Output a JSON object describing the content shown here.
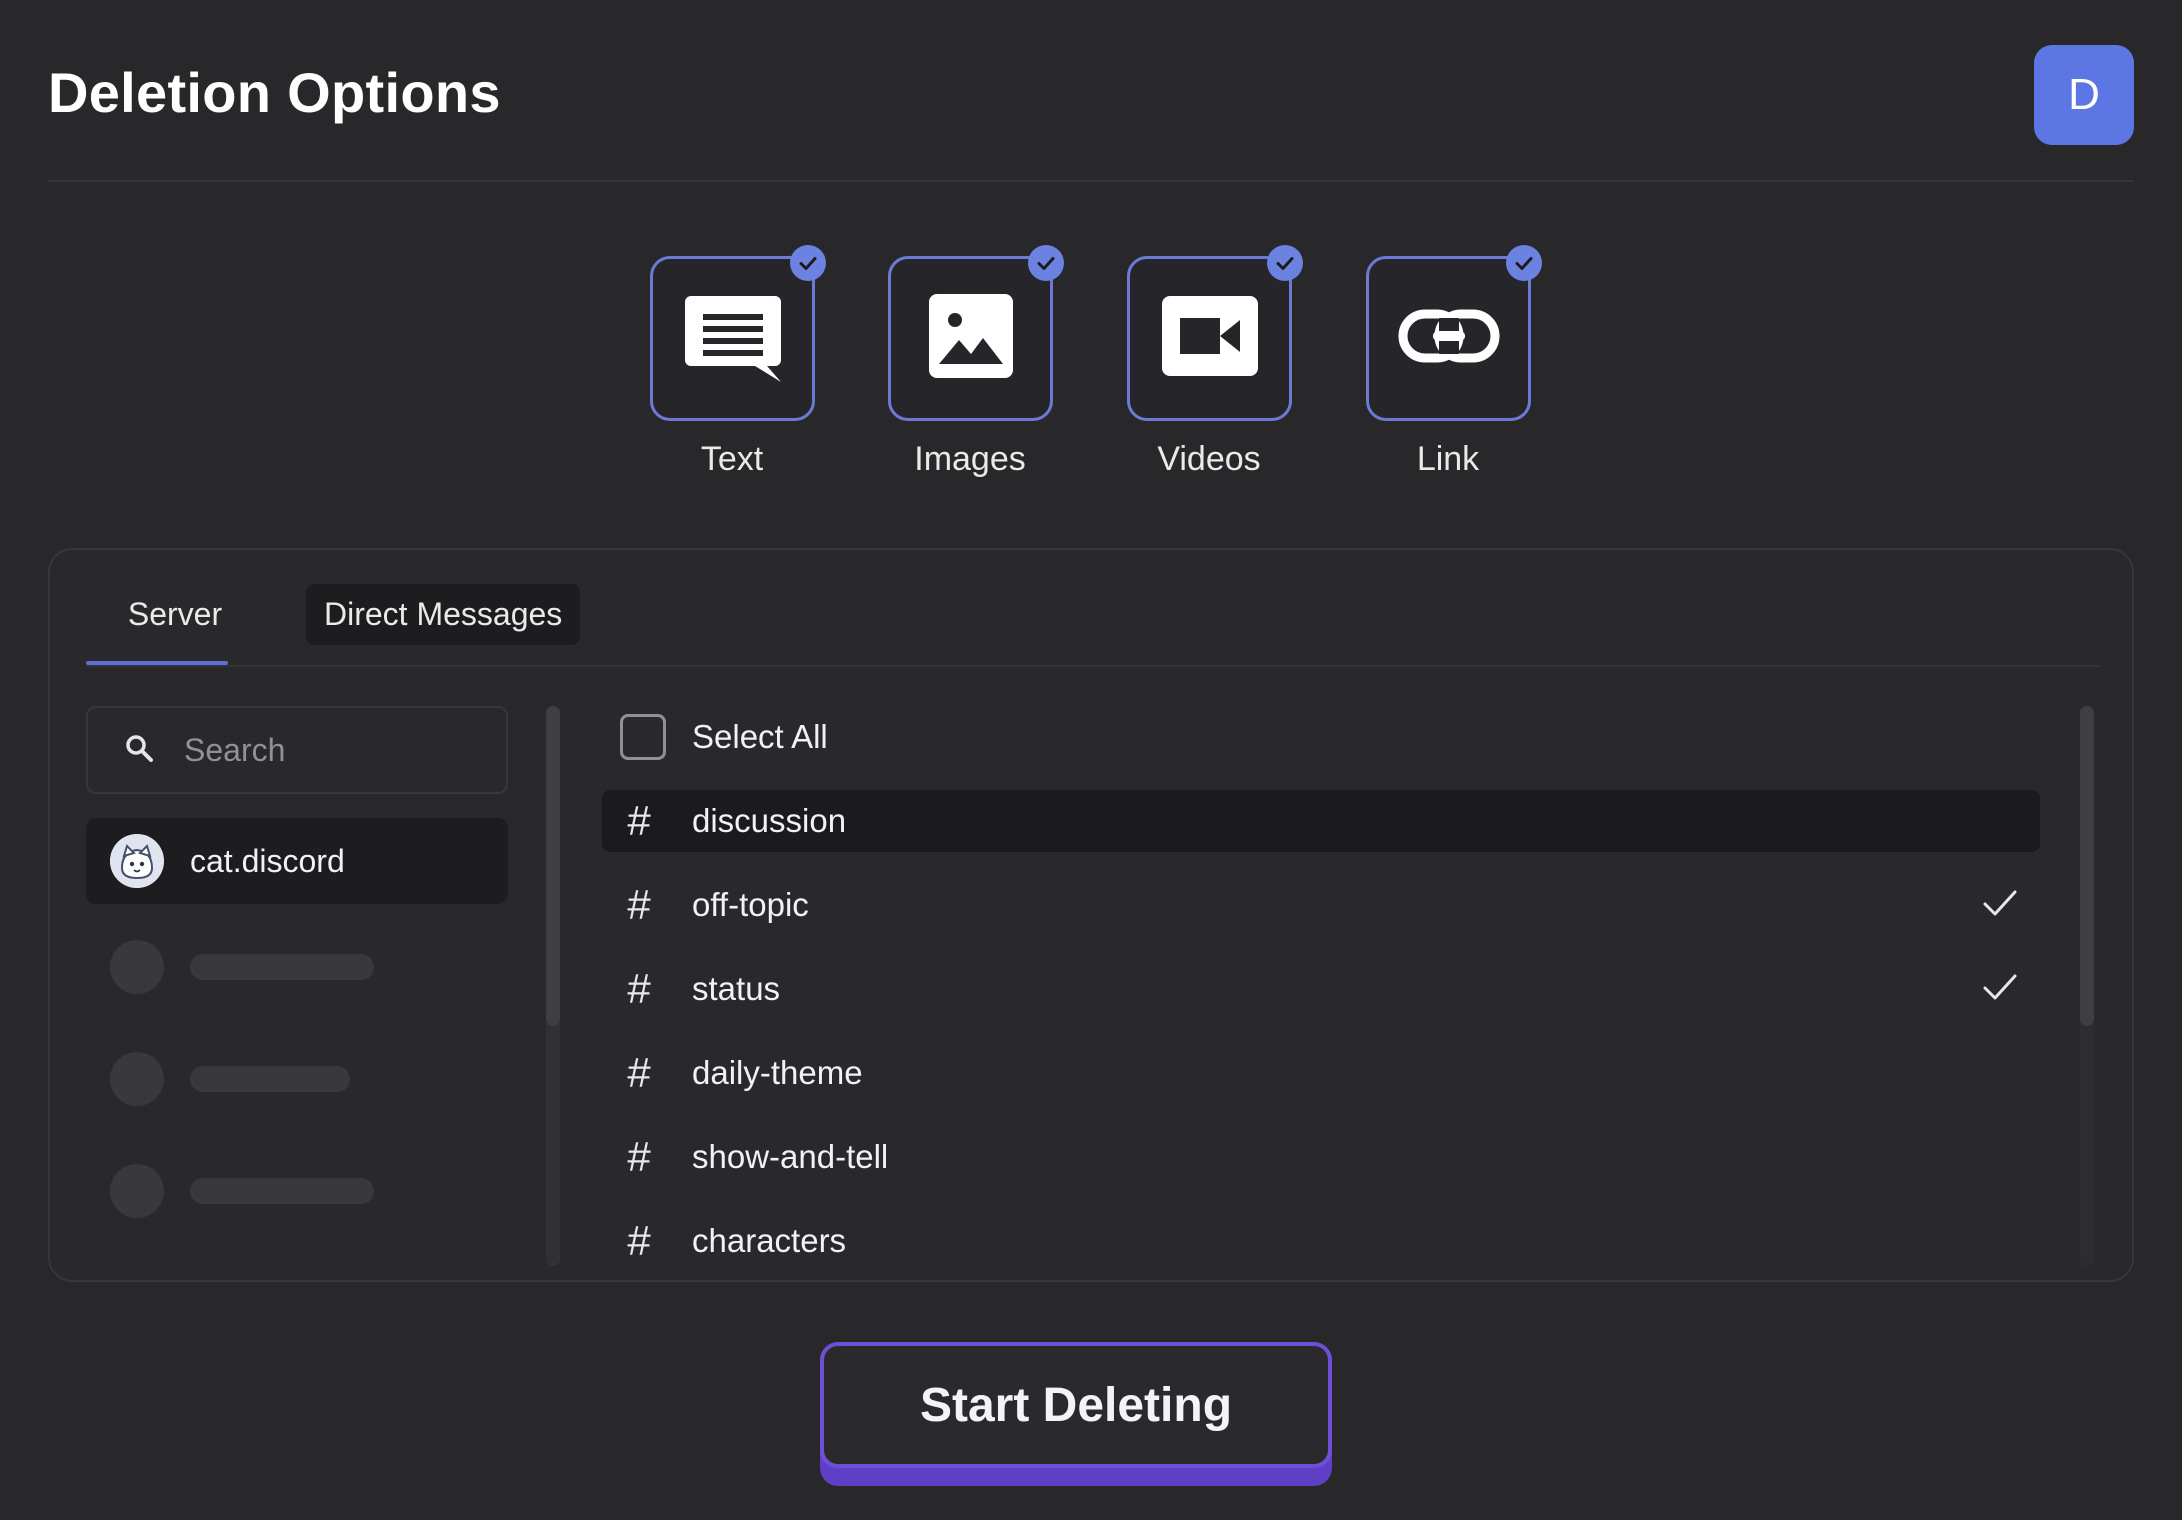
{
  "header": {
    "title": "Deletion Options",
    "avatar_initial": "D",
    "avatar_color": "#5c77e3"
  },
  "content_types": [
    {
      "label": "Text",
      "icon": "chat-bubble-icon",
      "checked": true
    },
    {
      "label": "Images",
      "icon": "image-icon",
      "checked": true
    },
    {
      "label": "Videos",
      "icon": "video-camera-icon",
      "checked": true
    },
    {
      "label": "Link",
      "icon": "link-icon",
      "checked": true
    }
  ],
  "tabs": {
    "server_label": "Server",
    "dm_label": "Direct Messages",
    "active": "Server"
  },
  "search": {
    "placeholder": "Search"
  },
  "servers": [
    {
      "name": "cat.discord",
      "icon": "cat-avatar-icon",
      "selected": true
    }
  ],
  "channels": {
    "select_all_label": "Select All",
    "select_all_checked": false,
    "items": [
      {
        "name": "discussion",
        "highlighted": true,
        "checked": false
      },
      {
        "name": "off-topic",
        "highlighted": false,
        "checked": true
      },
      {
        "name": "status",
        "highlighted": false,
        "checked": true
      },
      {
        "name": "daily-theme",
        "highlighted": false,
        "checked": false
      },
      {
        "name": "show-and-tell",
        "highlighted": false,
        "checked": false
      },
      {
        "name": "characters",
        "highlighted": false,
        "checked": false
      }
    ]
  },
  "actions": {
    "start_label": "Start Deleting",
    "accent_color": "#6d4fd8"
  }
}
